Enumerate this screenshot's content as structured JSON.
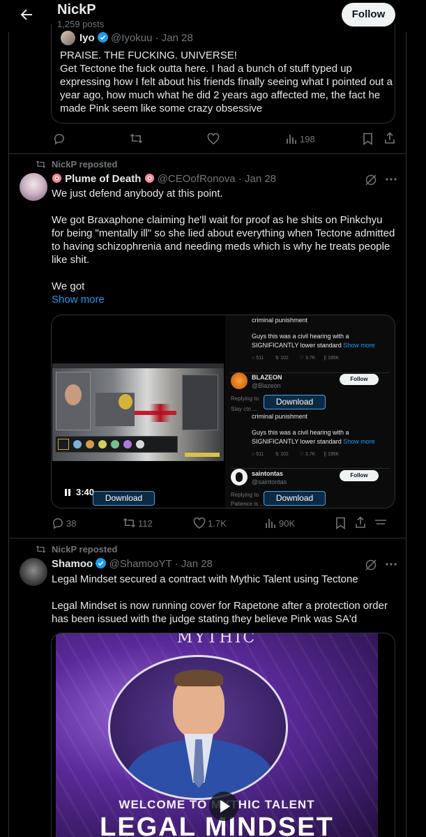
{
  "header": {
    "title": "NickP",
    "posts": "1,259 posts",
    "follow_label": "Follow"
  },
  "quote": {
    "name": "Iyo",
    "handle": "@Iyokuu",
    "date": "· Jan 28",
    "text": "PRAISE. THE FUCKING. UNIVERSE!\nGet Tectone the fuck outta here. I had a bunch of stuff typed up expressing how I felt about his friends finally seeing what I pointed out a year ago, how much what he did 2 years ago affected me, the fact he made Pink seem like some crazy obsessive"
  },
  "post1_actions": {
    "views": "198"
  },
  "post2": {
    "repost_label": "NickP reposted",
    "name": "Plume of Death",
    "handle": "@CEOofRonova",
    "date": "· Jan 28",
    "text": "We just defend anybody at this point.\n\nWe got Braxaphone claiming he'll wait for proof as he shits on Pinkchyu for being \"mentally ill\" so she lied about everything when Tectone admitted to having schizophrenia and needing meds which is why he treats people like shit.\n\nWe got",
    "show_more": "Show more",
    "video": {
      "time": "3:40"
    },
    "download_label": "Download",
    "embed": {
      "top_text_1": "criminal punishment",
      "reply_text": "Guys this was a civil hearing with a SIGNIFICANTLY lower standard",
      "reply_more": "Show more",
      "stats": {
        "replies": "511",
        "reposts": "102",
        "likes": "3.7K",
        "views": "195K"
      },
      "user1_name": "BLAZEON",
      "user1_handle": "@Blazeon",
      "user2_name": "saintontas",
      "user2_handle": "@saintontas",
      "follow_label": "Follow",
      "replying_to": "Replying to",
      "cut_text_1": "Stay ctn ...",
      "cut_text_2": "Patience is ..."
    },
    "actions": {
      "replies": "38",
      "reposts": "112",
      "likes": "1.7K",
      "views": "90K"
    }
  },
  "post3": {
    "repost_label": "NickP reposted",
    "name": "Shamoo",
    "handle": "@ShamooYT",
    "date": "· Jan 28",
    "text": "Legal Mindset secured a contract with Mythic Talent using Tectone\n\nLegal Mindset is now running cover for Rapetone after a protection order has been issued with the judge stating they believe Pink was SA'd",
    "image": {
      "top_text": "MYTHIC",
      "welcome": "WELCOME TO MYTHIC TALENT",
      "big": "LEGAL MINDSET"
    }
  },
  "colors": {
    "accent": "#1d9bf0",
    "verified": "#1d9bf0",
    "border": "#2f3336",
    "muted": "#71767b",
    "background": "#000000"
  }
}
